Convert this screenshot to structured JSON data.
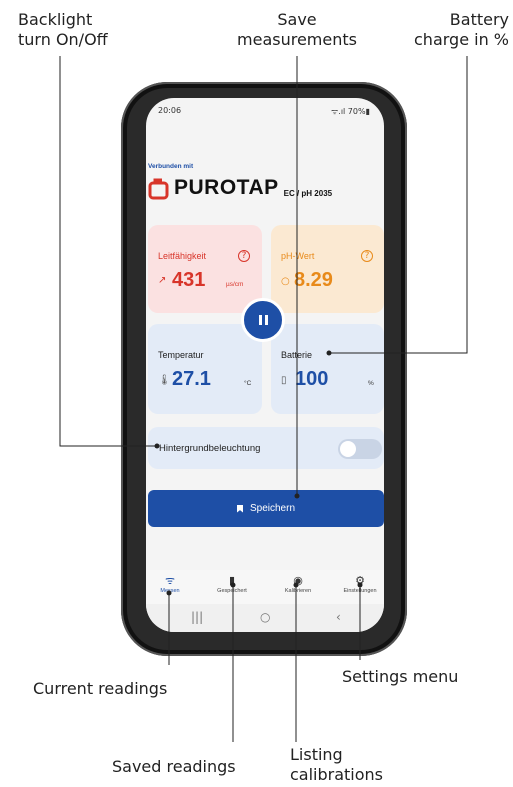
{
  "callouts": {
    "backlight_l1": "Backlight",
    "backlight_l2": "turn On/Off",
    "save_l1": "Save",
    "save_l2": "measurements",
    "battery_l1": "Battery",
    "battery_l2": "charge in %",
    "current": "Current readings",
    "settings": "Settings menu",
    "saved": "Saved readings",
    "listing_l1": "Listing",
    "listing_l2": "calibrations"
  },
  "status": {
    "time": "20:06",
    "right": "ᯤ.ıl 70%▮"
  },
  "header": {
    "connected_label": "Verbunden mit",
    "brand": "PUROTAP",
    "model": "EC / pH 2035"
  },
  "cards": {
    "conductivity": {
      "label": "Leitfähigkeit",
      "value": "431",
      "unit": "µs/cm",
      "help": "?"
    },
    "ph": {
      "label": "pH-Wert",
      "value": "8.29",
      "help": "?"
    },
    "temperature": {
      "label": "Temperatur",
      "value": "27.1",
      "unit": "°C"
    },
    "battery": {
      "label": "Batterie",
      "value": "100",
      "unit": "%"
    }
  },
  "backlight": {
    "label": "Hintergrundbeleuchtung",
    "on": false
  },
  "save_button": {
    "label": "Speichern"
  },
  "tabs": [
    {
      "label": "Messen",
      "icon": "wifi-signal-icon"
    },
    {
      "label": "Gespeichert",
      "icon": "bookmark-icon"
    },
    {
      "label": "Kalibrieren",
      "icon": "signal-dot-icon"
    },
    {
      "label": "Einstellungen",
      "icon": "gear-icon"
    }
  ],
  "colors": {
    "accent": "#1e4fa6",
    "cond_text": "#d8352a",
    "ph_text": "#e88a1a",
    "cond_bg": "#fbe1e1",
    "ph_bg": "#fbe9d2",
    "blue_bg": "#e3ebf7"
  },
  "navbar": {
    "recents": "|||",
    "home": "○",
    "back": "‹"
  }
}
